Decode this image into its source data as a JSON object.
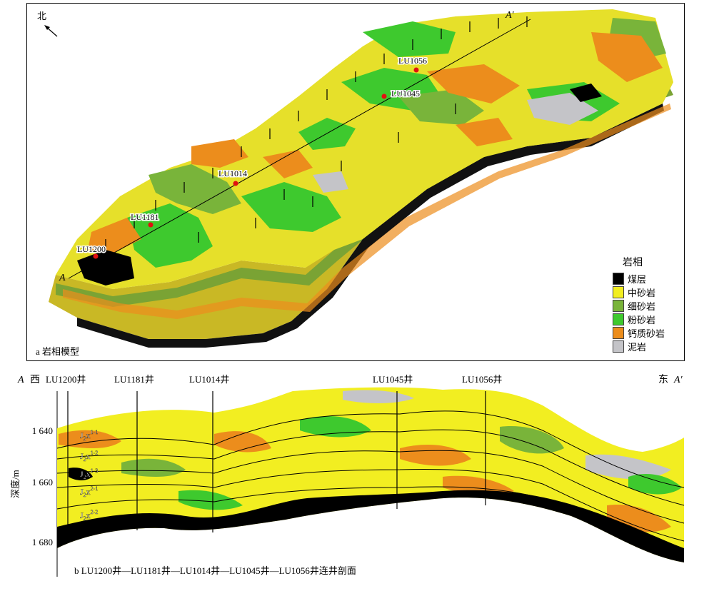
{
  "panel_a": {
    "caption": "a 岩相模型",
    "north_label": "北",
    "section_start": "A",
    "section_end": "A′",
    "wells": [
      "LU1200",
      "LU1181",
      "LU1014",
      "LU1045",
      "LU1056"
    ],
    "legend_title": "岩相",
    "legend": [
      {
        "label": "煤层",
        "color": "#000000"
      },
      {
        "label": "中砂岩",
        "color": "#f2ee21"
      },
      {
        "label": "细砂岩",
        "color": "#79b43a"
      },
      {
        "label": "粉砂岩",
        "color": "#3ec92e"
      },
      {
        "label": "钙质砂岩",
        "color": "#ec8d1c"
      },
      {
        "label": "泥岩",
        "color": "#c4c4c8"
      }
    ]
  },
  "panel_b": {
    "caption": "b LU1200井—LU1181井—LU1014井—LU1045井—LU1056井连井剖面",
    "west_label": "西",
    "east_label": "东",
    "section_start": "A",
    "section_end": "A′",
    "wells": [
      "LU1200井",
      "LU1181井",
      "LU1014井",
      "LU1045井",
      "LU1056井"
    ],
    "y_axis_label": "深度/m",
    "y_ticks": [
      "1 640",
      "1 660",
      "1 680"
    ],
    "layers": [
      {
        "base": "J",
        "sub": "2",
        "main": "x",
        "sub2": "1",
        "sup": "1-1"
      },
      {
        "base": "J",
        "sub": "2",
        "main": "x",
        "sub2": "1",
        "sup": "1-2"
      },
      {
        "base": "J",
        "sub": "2",
        "main": "x",
        "sub2": "1",
        "sup": "1-3"
      },
      {
        "base": "J",
        "sub": "2",
        "main": "x",
        "sub2": "1",
        "sup": "2-1"
      },
      {
        "base": "J",
        "sub": "2",
        "main": "x",
        "sub2": "1",
        "sup": "2-2"
      }
    ]
  }
}
